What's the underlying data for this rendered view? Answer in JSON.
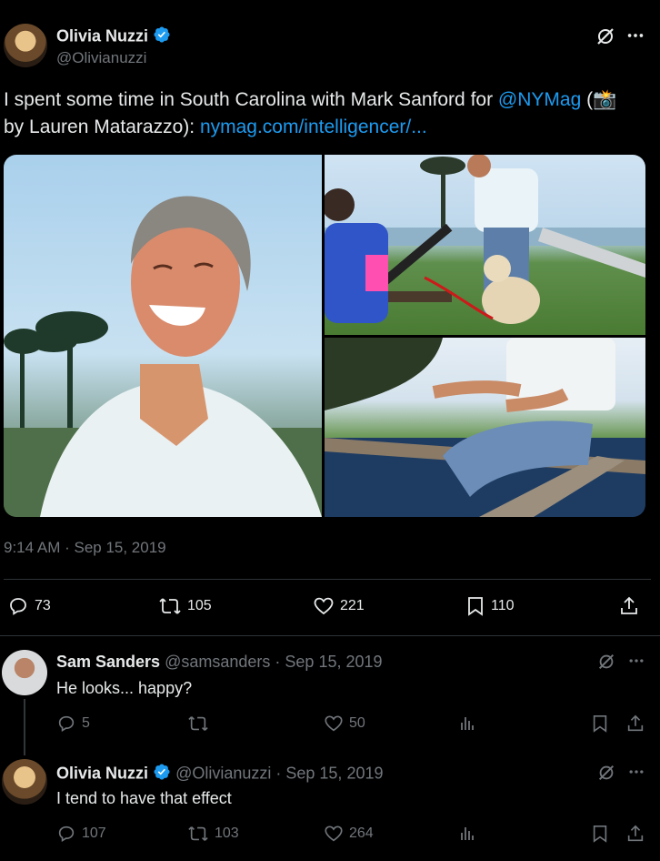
{
  "main_tweet": {
    "author_name": "Olivia Nuzzi",
    "author_handle": "@Olivianuzzi",
    "text_before_mention": "I spent some time in South Carolina with Mark Sanford for ",
    "mention": "@NYMag",
    "text_after_mention": " (",
    "camera_emoji": "📸",
    "text_line2_prefix": "by Lauren Matarazzo): ",
    "link": "nymag.com/intelligencer/...",
    "timestamp": "9:14 AM · Sep 15, 2019",
    "stats": {
      "replies": "73",
      "retweets": "105",
      "likes": "221",
      "bookmarks": "110"
    }
  },
  "replies": [
    {
      "author_name": "Sam Sanders",
      "author_handle": "@samsanders",
      "date": "· Sep 15, 2019",
      "text": "He looks... happy?",
      "replies": "5",
      "retweets": "",
      "likes": "50"
    },
    {
      "author_name": "Olivia Nuzzi",
      "author_handle": "@Olivianuzzi",
      "date": "· Sep 15, 2019",
      "text": "I tend to have that effect",
      "replies": "107",
      "retweets": "103",
      "likes": "264"
    }
  ],
  "colors": {
    "background": "#000000",
    "text": "#e7e9ea",
    "muted": "#71767b",
    "link": "#1d9bf0",
    "divider": "#2f3336"
  },
  "icons": [
    "grok-icon",
    "more-icon",
    "reply-icon",
    "retweet-icon",
    "like-icon",
    "bookmark-icon",
    "share-icon",
    "analytics-icon",
    "verified-icon"
  ]
}
